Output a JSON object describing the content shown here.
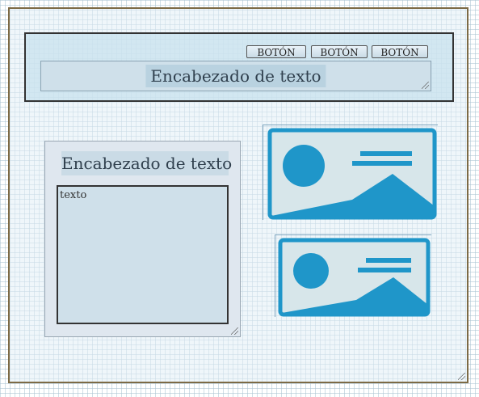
{
  "toolbar": {
    "buttons": [
      "BOTÓN",
      "BOTÓN",
      "BOTÓN"
    ]
  },
  "header": {
    "title": "Encabezado de texto"
  },
  "panel": {
    "heading": "Encabezado de texto",
    "text": "texto"
  },
  "images": [
    {
      "icon": "image-placeholder-icon"
    },
    {
      "icon": "image-placeholder-icon"
    }
  ],
  "colors": {
    "accent": "#1f96c9",
    "image_bg": "#d7e6ea",
    "frame_border": "#7d6a45"
  }
}
